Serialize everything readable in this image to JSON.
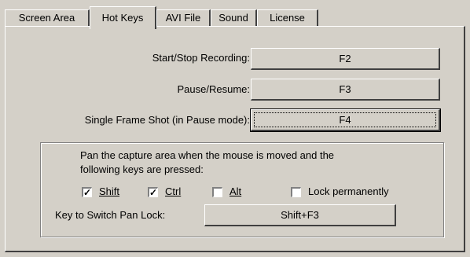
{
  "tabs": [
    {
      "label": "Screen Area",
      "active": false
    },
    {
      "label": "Hot Keys",
      "active": true
    },
    {
      "label": "AVI File",
      "active": false
    },
    {
      "label": "Sound",
      "active": false
    },
    {
      "label": "License",
      "active": false
    }
  ],
  "hotkeys": {
    "start_stop": {
      "label": "Start/Stop Recording:",
      "key": "F2"
    },
    "pause_resume": {
      "label": "Pause/Resume:",
      "key": "F3"
    },
    "single_frame": {
      "label": "Single Frame Shot (in Pause mode):",
      "key": "F4"
    }
  },
  "pan": {
    "description_line1": "Pan the capture area when the mouse is moved and the",
    "description_line2": "following keys are pressed:",
    "checkboxes": {
      "shift": {
        "label": "Shift",
        "checked": true
      },
      "ctrl": {
        "label": "Ctrl",
        "checked": true
      },
      "alt": {
        "label": "Alt",
        "checked": false
      },
      "lock": {
        "label": "Lock permanently",
        "checked": false
      }
    },
    "switch_label": "Key to Switch Pan Lock:",
    "switch_key": "Shift+F3"
  }
}
